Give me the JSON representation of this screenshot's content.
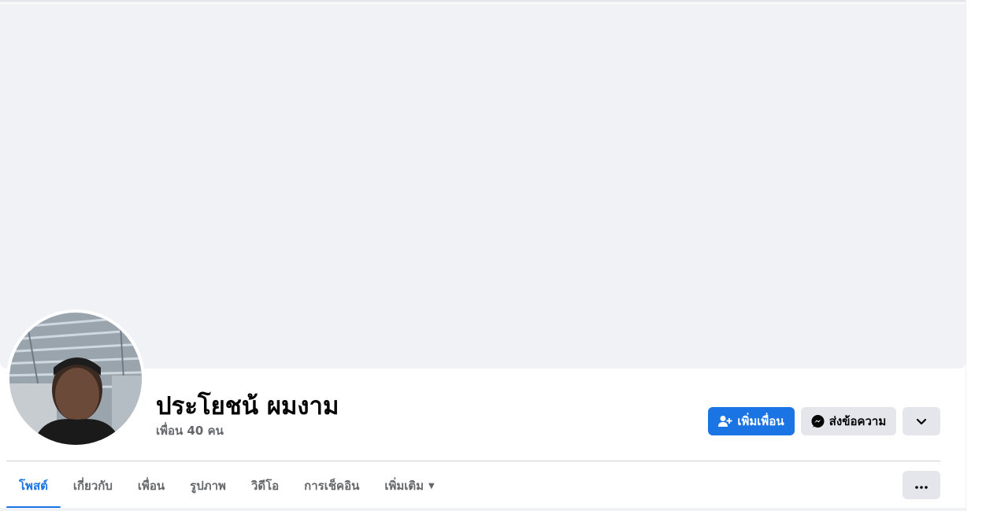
{
  "profile": {
    "name": "ประโยชน้ ผมงาม",
    "friends_count": "เพื่อน 40 คน"
  },
  "actions": {
    "add_friend_label": "เพิ่มเพื่อน",
    "message_label": "ส่งข้อความ",
    "more_icon": "chevron-down-icon"
  },
  "tabs": [
    {
      "label": "โพสต์",
      "active": true
    },
    {
      "label": "เกี่ยวกับ",
      "active": false
    },
    {
      "label": "เพื่อน",
      "active": false
    },
    {
      "label": "รูปภาพ",
      "active": false
    },
    {
      "label": "วิดีโอ",
      "active": false
    },
    {
      "label": "การเช็คอิน",
      "active": false
    },
    {
      "label": "เพิ่มเติม",
      "active": false
    }
  ],
  "colors": {
    "accent": "#1b74e4",
    "cover": "#f0f2f5",
    "secondary_button": "#e4e6eb",
    "muted_text": "#65676b"
  }
}
